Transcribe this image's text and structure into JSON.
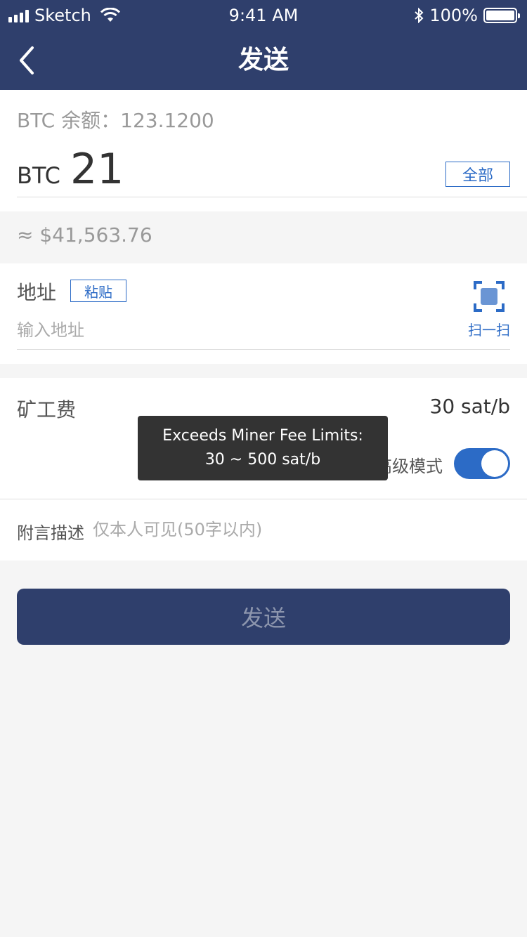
{
  "status_bar": {
    "carrier": "Sketch",
    "time": "9:41 AM",
    "battery": "100%"
  },
  "nav": {
    "title": "发送",
    "back_icon": "chevron-left-icon"
  },
  "balance": {
    "label": "BTC 余额：123.1200",
    "unit": "BTC",
    "amount": "21",
    "all_button": "全部"
  },
  "fiat": {
    "value": "≈ $41,563.76"
  },
  "address": {
    "label": "地址",
    "paste_button": "粘贴",
    "input_value": "",
    "placeholder": "输入地址",
    "scan_label": "扫一扫",
    "scan_icon": "scan-qr-icon"
  },
  "fee": {
    "label": "矿工费",
    "value": "30  sat/b",
    "advanced_label": "高级模式",
    "advanced_on": true
  },
  "note": {
    "label": "附言描述",
    "input_value": "",
    "placeholder": "仅本人可见(50字以内)"
  },
  "send_button": "发送",
  "toast": {
    "line1": "Exceeds Miner Fee Limits:",
    "line2": "30 ~ 500 sat/b"
  },
  "colors": {
    "header_bg": "#2f3f6c",
    "accent": "#2c6bc6",
    "toast_bg": "#333333"
  }
}
